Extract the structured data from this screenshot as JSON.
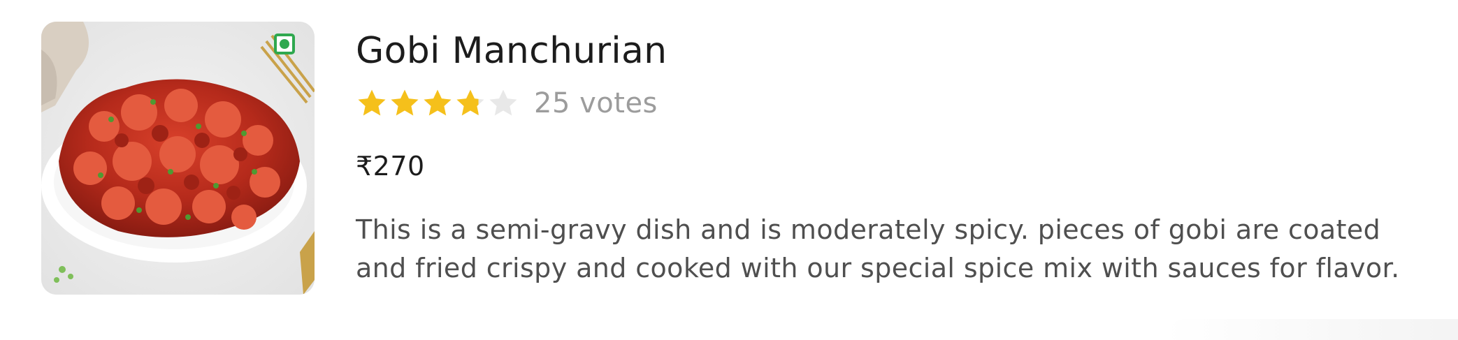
{
  "item": {
    "name": "Gobi Manchurian",
    "rating": 3.8,
    "rating_max": 5,
    "votes_label": "25 votes",
    "price": "₹270",
    "description": "This is a semi-gravy dish and is moderately spicy. pieces of gobi are coated and fried crispy and cooked with our special spice mix with sauces for flavor.",
    "diet_marker": "veg-icon",
    "image_icon": "food-dish-image"
  },
  "colors": {
    "star_filled": "#f5c01b",
    "star_empty": "#e8e8e8",
    "veg_green": "#2fa84f",
    "title_text": "#1c1c1c",
    "votes_text": "#9c9c9c",
    "description_text": "#4f4f4f"
  }
}
